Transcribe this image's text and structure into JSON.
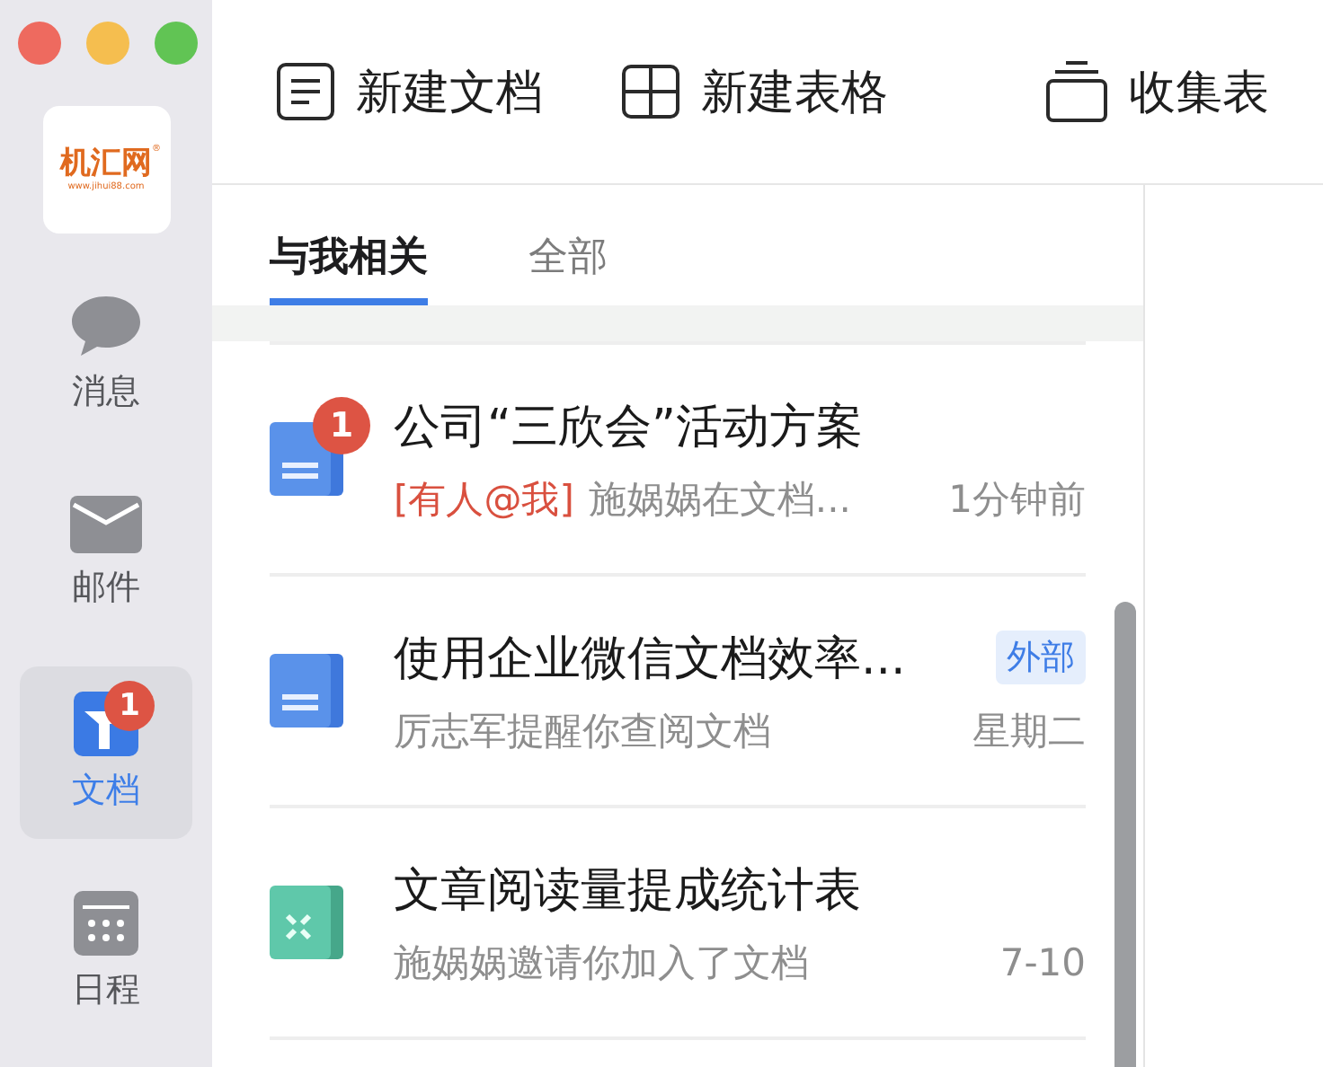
{
  "logo": {
    "name": "机汇网",
    "url": "www.jihui88.com",
    "mark": "®"
  },
  "sidebar": {
    "items": [
      {
        "kind": "chat",
        "label": "消息",
        "selected": false
      },
      {
        "kind": "mail",
        "label": "邮件",
        "selected": false
      },
      {
        "kind": "docs",
        "label": "文档",
        "selected": true,
        "badge": "1"
      },
      {
        "kind": "calendar",
        "label": "日程",
        "selected": false
      }
    ]
  },
  "toolbar": [
    {
      "kind": "doc",
      "label": "新建文档"
    },
    {
      "kind": "sheet",
      "label": "新建表格"
    },
    {
      "kind": "separator"
    },
    {
      "kind": "form",
      "label": "收集表"
    }
  ],
  "tabs": [
    {
      "label": "与我相关",
      "selected": true
    },
    {
      "label": "全部",
      "selected": false
    }
  ],
  "documents": [
    {
      "kind": "doc",
      "title": "公司“三欣会”活动方案",
      "badge": "1",
      "mention": "[有人@我]",
      "subtitle": "施娲娲在文档...",
      "time": "1分钟前"
    },
    {
      "kind": "doc",
      "title": "使用企业微信文档效率...",
      "tag": "外部",
      "subtitle": "厉志军提醒你查阅文档",
      "time": "星期二"
    },
    {
      "kind": "sheet",
      "title": "文章阅读量提成统计表",
      "subtitle": "施娲娲邀请你加入了文档",
      "time": "7-10"
    }
  ]
}
